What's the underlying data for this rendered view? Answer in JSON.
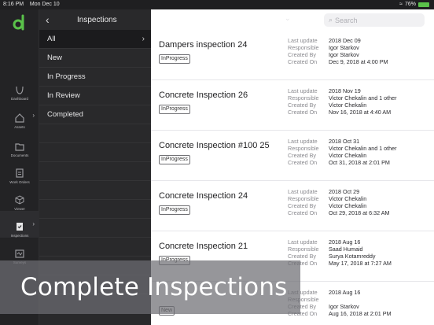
{
  "status_bar": {
    "time": "8:16 PM",
    "date": "Mon Dec 10",
    "battery": "76%"
  },
  "colors": {
    "accent_green": "#5ac24a",
    "rail_bg": "#232325",
    "filter_bg": "#29292b"
  },
  "rail": [
    {
      "label": "Dashboard",
      "icon": "dashboard-icon"
    },
    {
      "label": "Assets",
      "icon": "house-icon"
    },
    {
      "label": "Documents",
      "icon": "folder-icon"
    },
    {
      "label": "Work Orders",
      "icon": "clipboard-list-icon"
    },
    {
      "label": "Viewer",
      "icon": "cube-icon"
    },
    {
      "label": "Inspections",
      "icon": "clipboard-check-icon"
    },
    {
      "label": "Surveys",
      "icon": "survey-icon"
    }
  ],
  "filters": {
    "title": "Inspections",
    "items": [
      "All",
      "New",
      "In Progress",
      "In Review",
      "Completed"
    ]
  },
  "list": {
    "search_placeholder": "Search",
    "meta_labels": {
      "update": "Last update",
      "responsible": "Responsible",
      "created_by": "Created By",
      "created_on": "Created On"
    },
    "rows": [
      {
        "name": "Dampers inspection 24",
        "status": "InProgress",
        "last_update": "2018 Dec 09",
        "responsible": "Igor Starkov",
        "created_by": "Igor Starkov",
        "created_on": "Dec 9, 2018 at 4:00 PM"
      },
      {
        "name": "Concrete Inspection 26",
        "status": "InProgress",
        "last_update": "2018 Nov 19",
        "responsible": "Victor Chekalin and 1 other",
        "created_by": "Victor Chekalin",
        "created_on": "Nov 16, 2018 at 4:40 AM"
      },
      {
        "name": "Concrete Inspection #100 25",
        "status": "InProgress",
        "last_update": "2018 Oct 31",
        "responsible": "Victor Chekalin and 1 other",
        "created_by": "Victor Chekalin",
        "created_on": "Oct 31, 2018 at 2:01 PM"
      },
      {
        "name": "Concrete Inspection 24",
        "status": "InProgress",
        "last_update": "2018 Oct 29",
        "responsible": "Victor Chekalin",
        "created_by": "Victor Chekalin",
        "created_on": "Oct 29, 2018 at 6:32 AM"
      },
      {
        "name": "Concrete Inspection 21",
        "status": "InProgress",
        "last_update": "2018 Aug 16",
        "responsible": "Saad Humaid",
        "created_by": "Surya Kotamreddy",
        "created_on": "May 17, 2018 at 7:27 AM"
      },
      {
        "name": "",
        "status": "New",
        "last_update": "2018 Aug 16",
        "responsible": "",
        "created_by": "Igor Starkov",
        "created_on": "Aug 16, 2018 at 2:01 PM"
      }
    ]
  },
  "caption": "Complete Inspections"
}
